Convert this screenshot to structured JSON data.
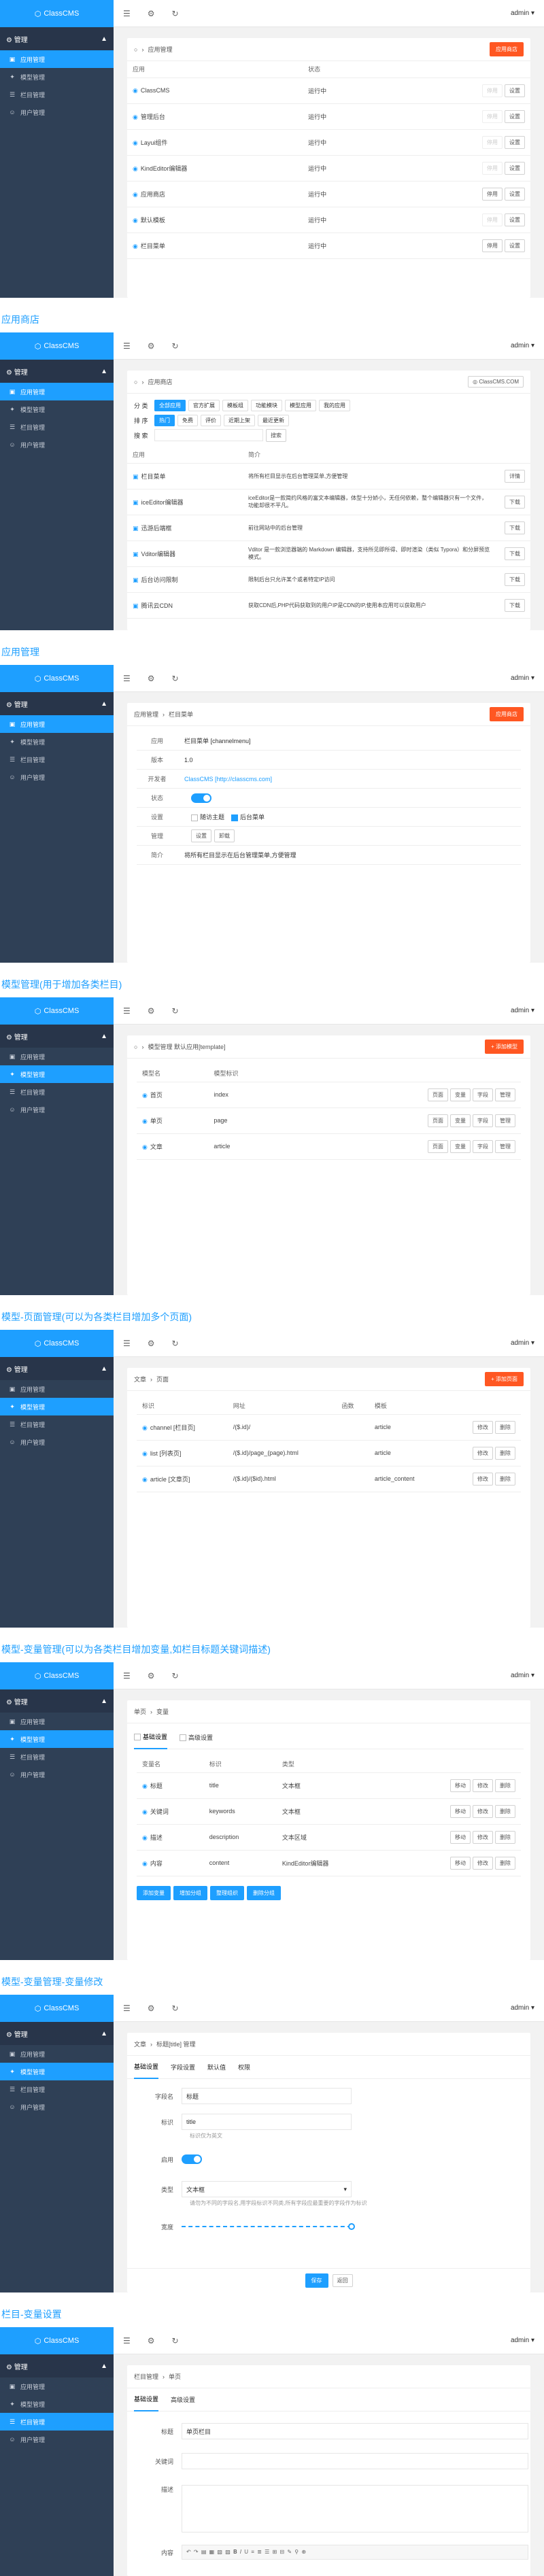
{
  "logo": "ClassCMS",
  "header": {
    "admin": "admin"
  },
  "sidebar": {
    "group": "管理",
    "items": [
      "应用管理",
      "模型管理",
      "栏目管理",
      "用户管理"
    ]
  },
  "captions": [
    "应用商店",
    "应用管理",
    "模型管理(用于增加各类栏目)",
    "模型-页面管理(可以为各类栏目增加多个页面)",
    "模型-变量管理(可以为各类栏目增加变量,如栏目标题关键词描述)",
    "模型-变量管理-变量修改",
    "栏目-变量设置"
  ],
  "s1": {
    "crumb": "应用管理",
    "btn": "应用商店",
    "cols": [
      "应用",
      "状态"
    ],
    "rows": [
      {
        "name": "ClassCMS",
        "status": "运行中"
      },
      {
        "name": "管理后台",
        "status": "运行中"
      },
      {
        "name": "Layui组件",
        "status": "运行中"
      },
      {
        "name": "KindEditor编辑器",
        "status": "运行中"
      },
      {
        "name": "应用商店",
        "status": "运行中"
      },
      {
        "name": "默认模板",
        "status": "运行中"
      },
      {
        "name": "栏目菜单",
        "status": "运行中"
      }
    ],
    "ops": [
      "停用",
      "设置"
    ]
  },
  "s2": {
    "crumb": "应用商店",
    "site": "ClassCMS.COM",
    "cat_label": "分 类",
    "cats": [
      "全部应用",
      "官方扩展",
      "模板组",
      "功能模块",
      "模型应用",
      "我的应用"
    ],
    "sort_label": "排 序",
    "sorts": [
      "热门",
      "免费",
      "评价",
      "近期上架",
      "最近更新"
    ],
    "search_label": "搜 索",
    "search_btn": "搜索",
    "cols": [
      "应用",
      "简介"
    ],
    "rows": [
      {
        "name": "栏目菜单",
        "desc": "将所有栏目显示在后台管理菜单,方便管理",
        "op": "详情"
      },
      {
        "name": "iceEditor编辑器",
        "desc": "iceEditor是一款简约风格的富文本编辑器，体型十分娇小，无任何依赖，整个编辑器只有一个文件，功能却很不平凡。",
        "op": "下载"
      },
      {
        "name": "迅游后端框",
        "desc": "前往网站中的后台管理",
        "op": "下载"
      },
      {
        "name": "Vditor编辑器",
        "desc": "Vditor 是一款浏览器端的 Markdown 编辑器，支持所见即所得、即时渲染（类似 Typora）和分屏预览模式。",
        "op": "下载"
      },
      {
        "name": "后台访问限制",
        "desc": "限制后台只允许某个或者特定IP访问",
        "op": "下载"
      },
      {
        "name": "腾讯云CDN",
        "desc": "获取CDN后,PHP代码获取到的用户IP是CDN的IP,使用本应用可以获取用户",
        "op": "下载"
      }
    ]
  },
  "s3": {
    "crumb1": "应用管理",
    "crumb2": "栏目菜单",
    "btn": "应用商店",
    "rows": [
      {
        "k": "应用",
        "v": "栏目菜单 [channelmenu]"
      },
      {
        "k": "版本",
        "v": "1.0"
      },
      {
        "k": "开发者",
        "v": "ClassCMS [http://classcms.com]"
      },
      {
        "k": "状态",
        "v": ""
      },
      {
        "k": "设置",
        "v": ""
      },
      {
        "k": "管理",
        "v": ""
      },
      {
        "k": "简介",
        "v": "将所有栏目显示在后台管理菜单,方便管理"
      }
    ],
    "set1": "随访主题",
    "set2": "后台菜单",
    "mgr1": "设置",
    "mgr2": "卸载"
  },
  "s4": {
    "crumb": "模型管理 默认应用[template]",
    "btn": "+ 添加模型",
    "cols": [
      "模型名",
      "模型标识"
    ],
    "rows": [
      {
        "name": "首页",
        "id": "index"
      },
      {
        "name": "单页",
        "id": "page"
      },
      {
        "name": "文章",
        "id": "article"
      }
    ],
    "ops": [
      "页面",
      "变量",
      "字段",
      "管理"
    ]
  },
  "s5": {
    "crumb1": "文章",
    "crumb2": "页面",
    "btn": "+ 添加页面",
    "cols": [
      "标识",
      "网址",
      "函数",
      "模板"
    ],
    "rows": [
      {
        "id": "channel [栏目页]",
        "url": "/($.id)/",
        "fn": "",
        "tpl": "article"
      },
      {
        "id": "list [列表页]",
        "url": "/($.id)/page_(page).html",
        "fn": "",
        "tpl": "article"
      },
      {
        "id": "article [文章页]",
        "url": "/($.id)/($id).html",
        "fn": "",
        "tpl": "article_content"
      }
    ],
    "ops": [
      "修改",
      "删除"
    ]
  },
  "s6": {
    "crumb1": "单页",
    "crumb2": "变量",
    "tabs": [
      "基础设置",
      "高级设置"
    ],
    "cols": [
      "变量名",
      "标识",
      "类型"
    ],
    "rows": [
      {
        "name": "标题",
        "id": "title",
        "type": "文本框"
      },
      {
        "name": "关键词",
        "id": "keywords",
        "type": "文本框"
      },
      {
        "name": "描述",
        "id": "description",
        "type": "文本区域"
      },
      {
        "name": "内容",
        "id": "content",
        "type": "KindEditor编辑器"
      }
    ],
    "ops": [
      "移动",
      "修改",
      "删除"
    ],
    "btns": [
      "添加变量",
      "增加分组",
      "整理组织",
      "删除分组"
    ]
  },
  "s7": {
    "crumb1": "文章",
    "crumb2": "标题[title] 管理",
    "tabs": [
      "基础设置",
      "字段设置",
      "默认值",
      "权限"
    ],
    "f1": "字段名",
    "v1": "标题",
    "f2": "标识",
    "v2": "title",
    "hint2": "标识仅为英文",
    "f3": "启用",
    "f4": "类型",
    "v4": "文本框",
    "hint4": "请勿为不同的字段名,用字段标识不同类,所有字段应最重要的字段作为标识",
    "f5": "宽度",
    "save": "保存",
    "back": "返回"
  },
  "s8": {
    "crumb1": "栏目管理",
    "crumb2": "单页",
    "tabs": [
      "基础设置",
      "高级设置"
    ],
    "f1": "标题",
    "v1": "单页栏目",
    "f2": "关键词",
    "f3": "描述",
    "f4": "内容"
  }
}
